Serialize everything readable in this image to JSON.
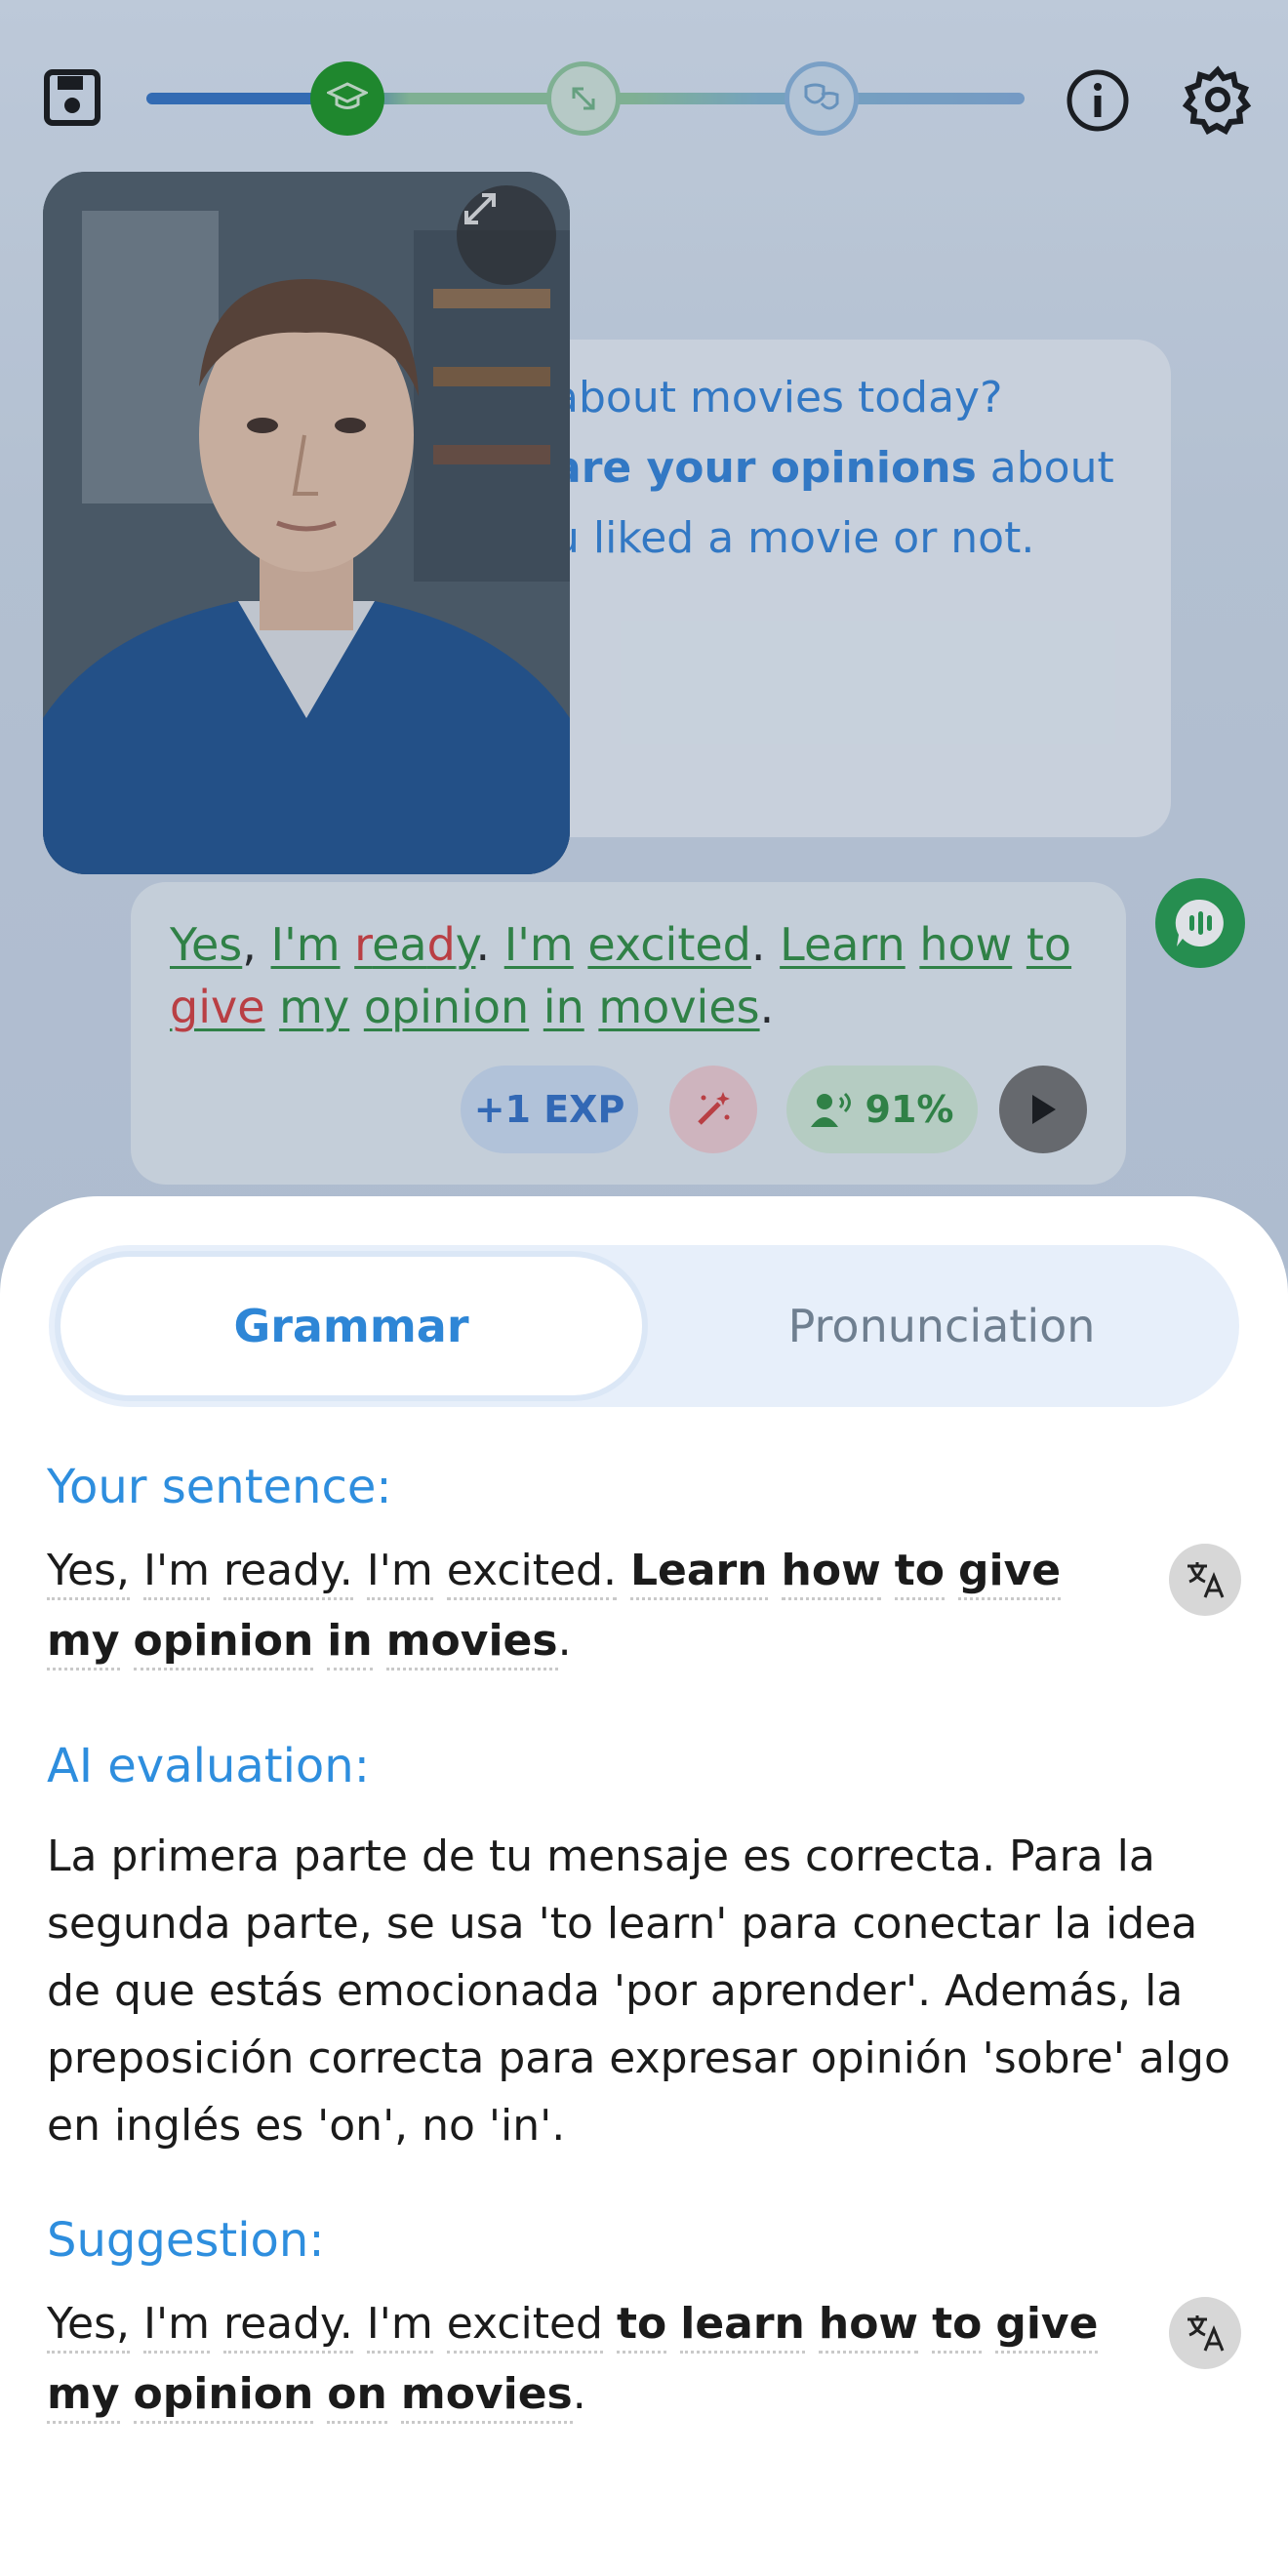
{
  "topbar": {
    "icons": [
      "save-icon",
      "graduation-cap-icon",
      "expand-arrows-icon",
      "theater-masks-icon",
      "info-icon",
      "gear-icon"
    ],
    "progress_color": "#2f6fc1",
    "active_step_color": "#16921f"
  },
  "conversation": {
    "ai_message": {
      "line1": "about movies today?",
      "line2_bold": "are your opinions",
      "line2_rest": " about",
      "line3": "u liked a movie or not."
    },
    "user_message": {
      "words": [
        "Yes",
        ",",
        "I'm",
        "ready",
        ".",
        "I'm",
        "excited",
        ".",
        "Learn",
        "how",
        "to",
        "give",
        "my",
        "opinion",
        "in",
        "movies",
        "."
      ]
    },
    "chips": {
      "exp_label": "+1 EXP",
      "pronunciation_score": "91%"
    }
  },
  "sheet": {
    "tabs": [
      {
        "label": "Grammar",
        "active": true
      },
      {
        "label": "Pronunciation",
        "active": false
      }
    ],
    "your_sentence": {
      "title": "Your sentence:",
      "plain": [
        "Yes,",
        "I'm",
        "ready.",
        "I'm",
        "excited."
      ],
      "bold": [
        "Learn",
        "how",
        "to",
        "give",
        "my",
        "opinion",
        "in",
        "movies"
      ],
      "end": "."
    },
    "ai_evaluation": {
      "title": "AI evaluation:",
      "text": "La primera parte de tu mensaje es correcta. Para la segunda parte, se usa 'to learn' para conectar la idea de que estás emocionada 'por aprender'. Además, la preposición correcta para expresar opinión 'sobre' algo en inglés es 'on', no 'in'."
    },
    "suggestion": {
      "title": "Suggestion:",
      "plain": [
        "Yes,",
        "I'm",
        "ready.",
        "I'm",
        "excited"
      ],
      "bold": [
        "to",
        "learn",
        "how",
        "to",
        "give",
        "my",
        "opinion",
        "on",
        "movies"
      ],
      "end": "."
    },
    "accent_color": "#2e8ede"
  }
}
